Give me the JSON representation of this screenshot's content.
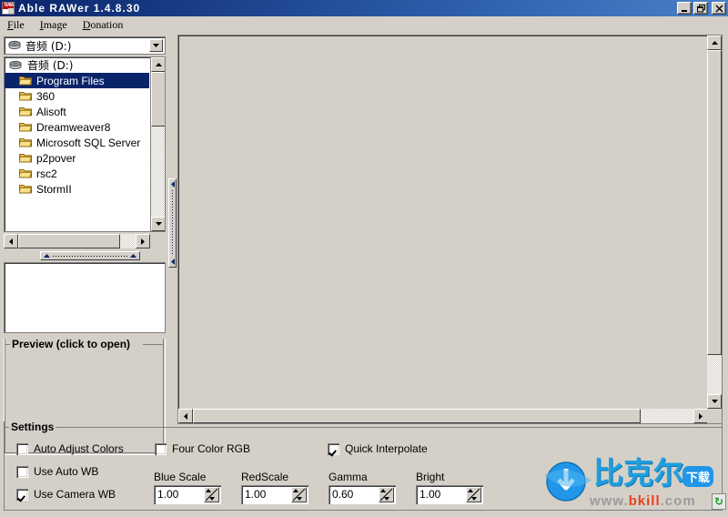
{
  "window": {
    "title": "Able RAWer 1.4.8.30",
    "icon": "raw-file-icon",
    "buttons": {
      "minimize": "minimize-icon",
      "maximize": "maximize-icon",
      "close": "close-icon"
    }
  },
  "menu": {
    "items": [
      {
        "label": "File",
        "accel": "F"
      },
      {
        "label": "Image",
        "accel": "I"
      },
      {
        "label": "Donation",
        "accel": "D"
      }
    ]
  },
  "left_panel": {
    "drive_combo": {
      "value": "音频 (D:)",
      "icon": "drive-icon",
      "arrow": "chevron-down-icon"
    },
    "tree": {
      "root": {
        "label": "音频 (D:)",
        "icon": "drive-icon"
      },
      "items": [
        {
          "label": "Program Files",
          "icon": "folder-icon",
          "selected": true
        },
        {
          "label": "360",
          "icon": "folder-icon",
          "selected": false
        },
        {
          "label": "Alisoft",
          "icon": "folder-icon",
          "selected": false
        },
        {
          "label": "Dreamweaver8",
          "icon": "folder-icon",
          "selected": false
        },
        {
          "label": "Microsoft SQL Server",
          "icon": "folder-icon",
          "selected": false
        },
        {
          "label": "p2pover",
          "icon": "folder-icon",
          "selected": false
        },
        {
          "label": "rsc2",
          "icon": "folder-icon",
          "selected": false
        },
        {
          "label": "StormII",
          "icon": "folder-icon",
          "selected": false
        }
      ]
    },
    "file_list": {
      "items": []
    },
    "preview_group": {
      "label": "Preview (click to open)",
      "content": ""
    }
  },
  "main_panel": {
    "image": "",
    "background_color": "#d4d0c8"
  },
  "settings": {
    "label": "Settings",
    "checkboxes": [
      {
        "label": "Auto Adjust Colors",
        "checked": false
      },
      {
        "label": "Use Auto WB",
        "checked": false
      },
      {
        "label": "Use Camera WB",
        "checked": true
      },
      {
        "label": "Four Color RGB",
        "checked": false
      },
      {
        "label": "Quick Interpolate",
        "checked": true
      }
    ],
    "fields": [
      {
        "label": "Blue Scale",
        "value": "1.00"
      },
      {
        "label": "RedScale",
        "value": "1.00"
      },
      {
        "label": "Gamma",
        "value": "0.60"
      },
      {
        "label": "Bright",
        "value": "1.00"
      }
    ]
  },
  "watermark": {
    "brand_cn": "比克尔",
    "download_cn": "下载",
    "url_prefix": "www.",
    "url_brand": "bkill",
    "url_suffix": ".com",
    "colors": {
      "blue": "#1f9fe0",
      "red": "#e8401f",
      "gray": "#9b9b9b"
    }
  }
}
